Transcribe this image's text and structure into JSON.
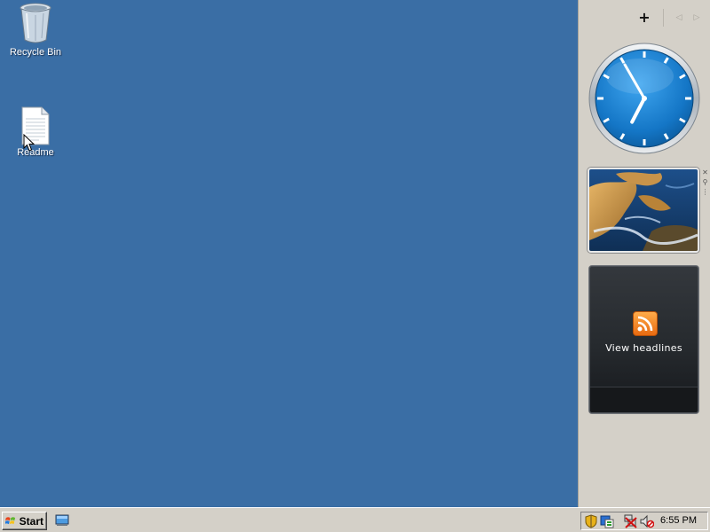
{
  "desktop": {
    "background": "#3a6ea5",
    "icons": [
      {
        "label": "Recycle Bin",
        "icon": "recycle-bin-icon"
      },
      {
        "label": "Readme",
        "icon": "text-document-icon"
      }
    ]
  },
  "sidebar": {
    "add_gadget": "+",
    "nav_prev": "◁",
    "nav_next": "▷"
  },
  "gadgets": {
    "clock": {
      "hour": 6,
      "minute": 55
    },
    "slideshow": {
      "subject": "rocky coast seascape"
    },
    "feed": {
      "label": "View headlines",
      "icon": "rss-feed-icon"
    }
  },
  "taskbar": {
    "start_label": "Start",
    "quick_launch_icon": "show-desktop-icon",
    "tray_icons": [
      "security-shield-icon",
      "language-bar-icon",
      "network-disconnected-icon",
      "volume-muted-icon"
    ],
    "clock": "6:55 PM"
  }
}
